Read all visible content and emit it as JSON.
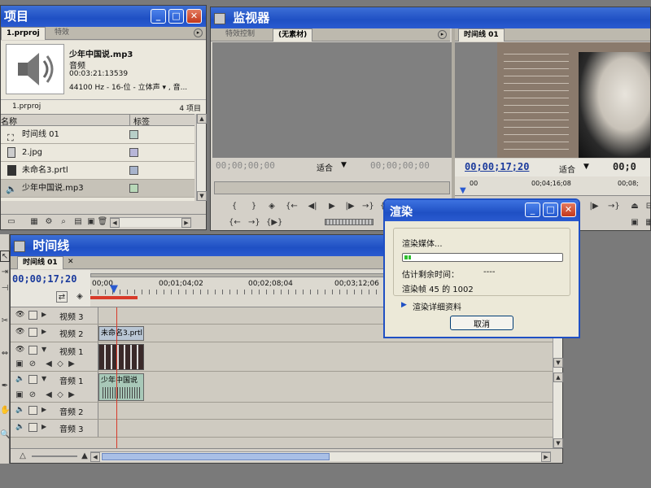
{
  "project": {
    "title": "项目",
    "tab_project": "1.prproj",
    "tab_effects": "特效",
    "preview_name": "少年中国说.mp3",
    "preview_type": "音频",
    "preview_duration": "00:03:21:13539",
    "preview_format": "44100 Hz - 16-位 - 立体声 ▾ , 音...",
    "bin_name": "1.prproj",
    "item_count": "4 项目",
    "col_name": "名称",
    "col_label": "标签",
    "items": [
      {
        "name": "时间线 01",
        "icon": "sequence-icon",
        "color": "#b8cfc8"
      },
      {
        "name": "2.jpg",
        "icon": "image-icon",
        "color": "#b8b6d8"
      },
      {
        "name": "未命名3.prtl",
        "icon": "title-icon",
        "color": "#a8b4cc"
      },
      {
        "name": "少年中国说.mp3",
        "icon": "audio-icon",
        "color": "#b8d8b8"
      }
    ]
  },
  "monitor": {
    "title": "监视器",
    "tab_effect_controls": "特效控制",
    "tab_no_clip": "(无素材)",
    "source_tc_left": "00;00;00;00",
    "source_fit": "适合",
    "source_tc_right": "00;00;00;00",
    "program_tab": "时间线 01",
    "program_tc": "00;00;17;20",
    "program_fit": "适合",
    "program_tc_right": "00;0",
    "ruler_a": "00",
    "ruler_b": "00;04;16;08",
    "ruler_c": "00;08;"
  },
  "render": {
    "title": "渲染",
    "status": "渲染媒体...",
    "progress": 0.04,
    "time_label": "估计剩余时间：",
    "time_value": "----",
    "frame_text": "渲染帧 45 的 1002",
    "details_label": "渲染详细资料",
    "cancel_label": "取消"
  },
  "timeline": {
    "title": "时间线",
    "tab": "时间线 01",
    "timecode": "00;00;17;20",
    "ruler": [
      "00;00",
      "00;01;04;02",
      "00;02;08;04",
      "00;03;12;06"
    ],
    "tracks": {
      "v3": "视频 3",
      "v2": "视频 2",
      "v1": "视频 1",
      "a1": "音频 1",
      "a2": "音频 2",
      "a3": "音频 3"
    },
    "clip_title": "未命名3.prtl",
    "clip_audio": "少年中国说"
  },
  "colors": {
    "title_bar": "#2456c8",
    "progress": "#2fbf2f",
    "playhead": "#d83a2a"
  }
}
